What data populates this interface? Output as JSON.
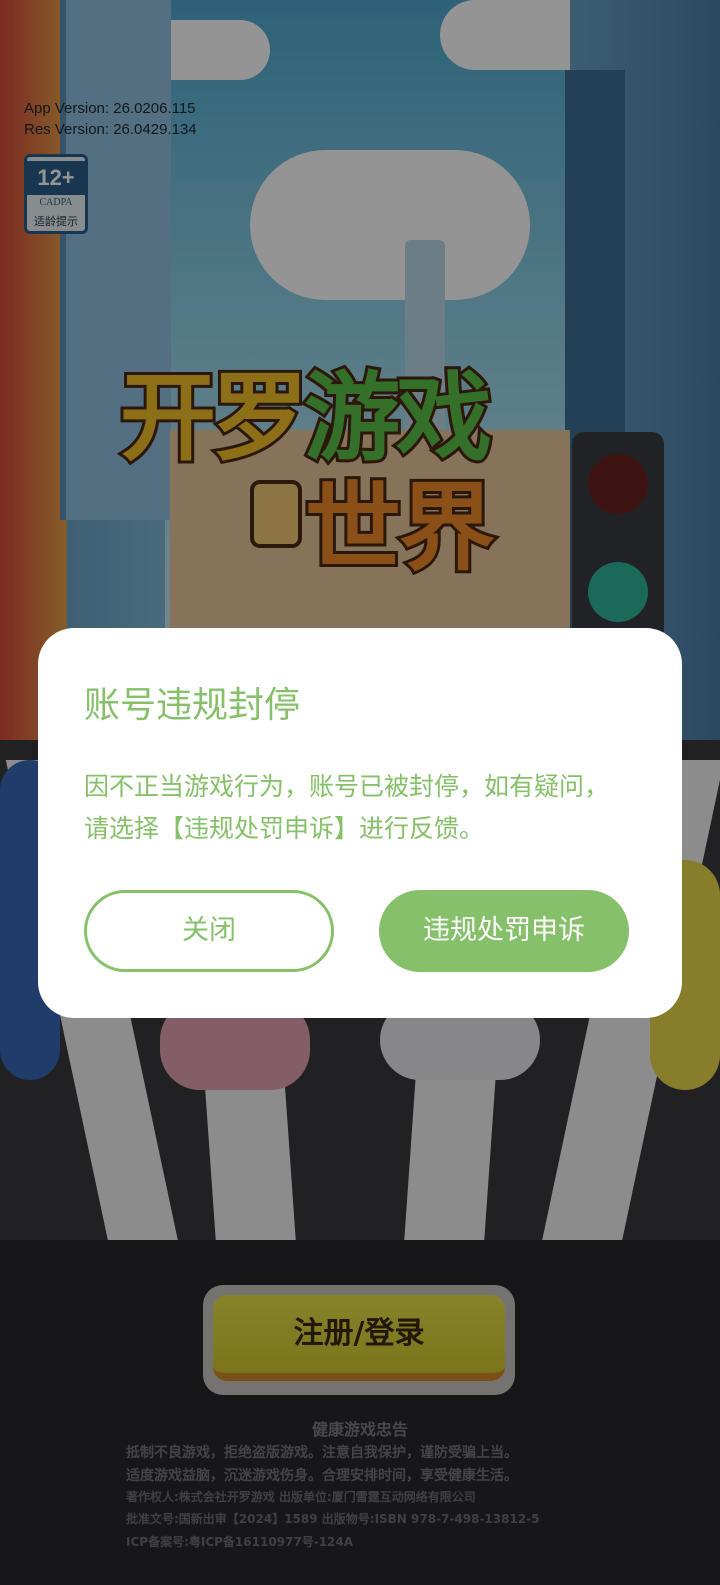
{
  "version": {
    "app": "App Version: 26.0206.115",
    "res": "Res Version: 26.0429.134"
  },
  "age_rating": {
    "age": "12+",
    "org": "CADPA",
    "tip": "适龄提示"
  },
  "logo": {
    "line1_a": "开罗",
    "line1_b": "游戏",
    "line2": "世界"
  },
  "login": {
    "label": "注册/登录"
  },
  "footer": {
    "title": "健康游戏忠告",
    "advice_1": "抵制不良游戏，拒绝盗版游戏。注意自我保护，谨防受骗上当。",
    "advice_2": "适度游戏益脑，沉迷游戏伤身。合理安排时间，享受健康生活。",
    "copyright": "著作权人:株式会社开罗游戏 出版单位:厦门雷霆互动网络有限公司",
    "approval": "批准文号:国新出审【2024】1589     出版物号:ISBN 978-7-498-13812-5",
    "icp": "ICP备案号:粤ICP备16110977号-124A"
  },
  "dialog": {
    "title": "账号违规封停",
    "message": "因不正当游戏行为，账号已被封停，如有疑问，请选择【违规处罚申诉】进行反馈。",
    "close_label": "关闭",
    "appeal_label": "违规处罚申诉"
  },
  "colors": {
    "accent": "#86c06a",
    "overlay": "rgba(0,0,0,0.42)",
    "login_button": "#e0d63c"
  }
}
